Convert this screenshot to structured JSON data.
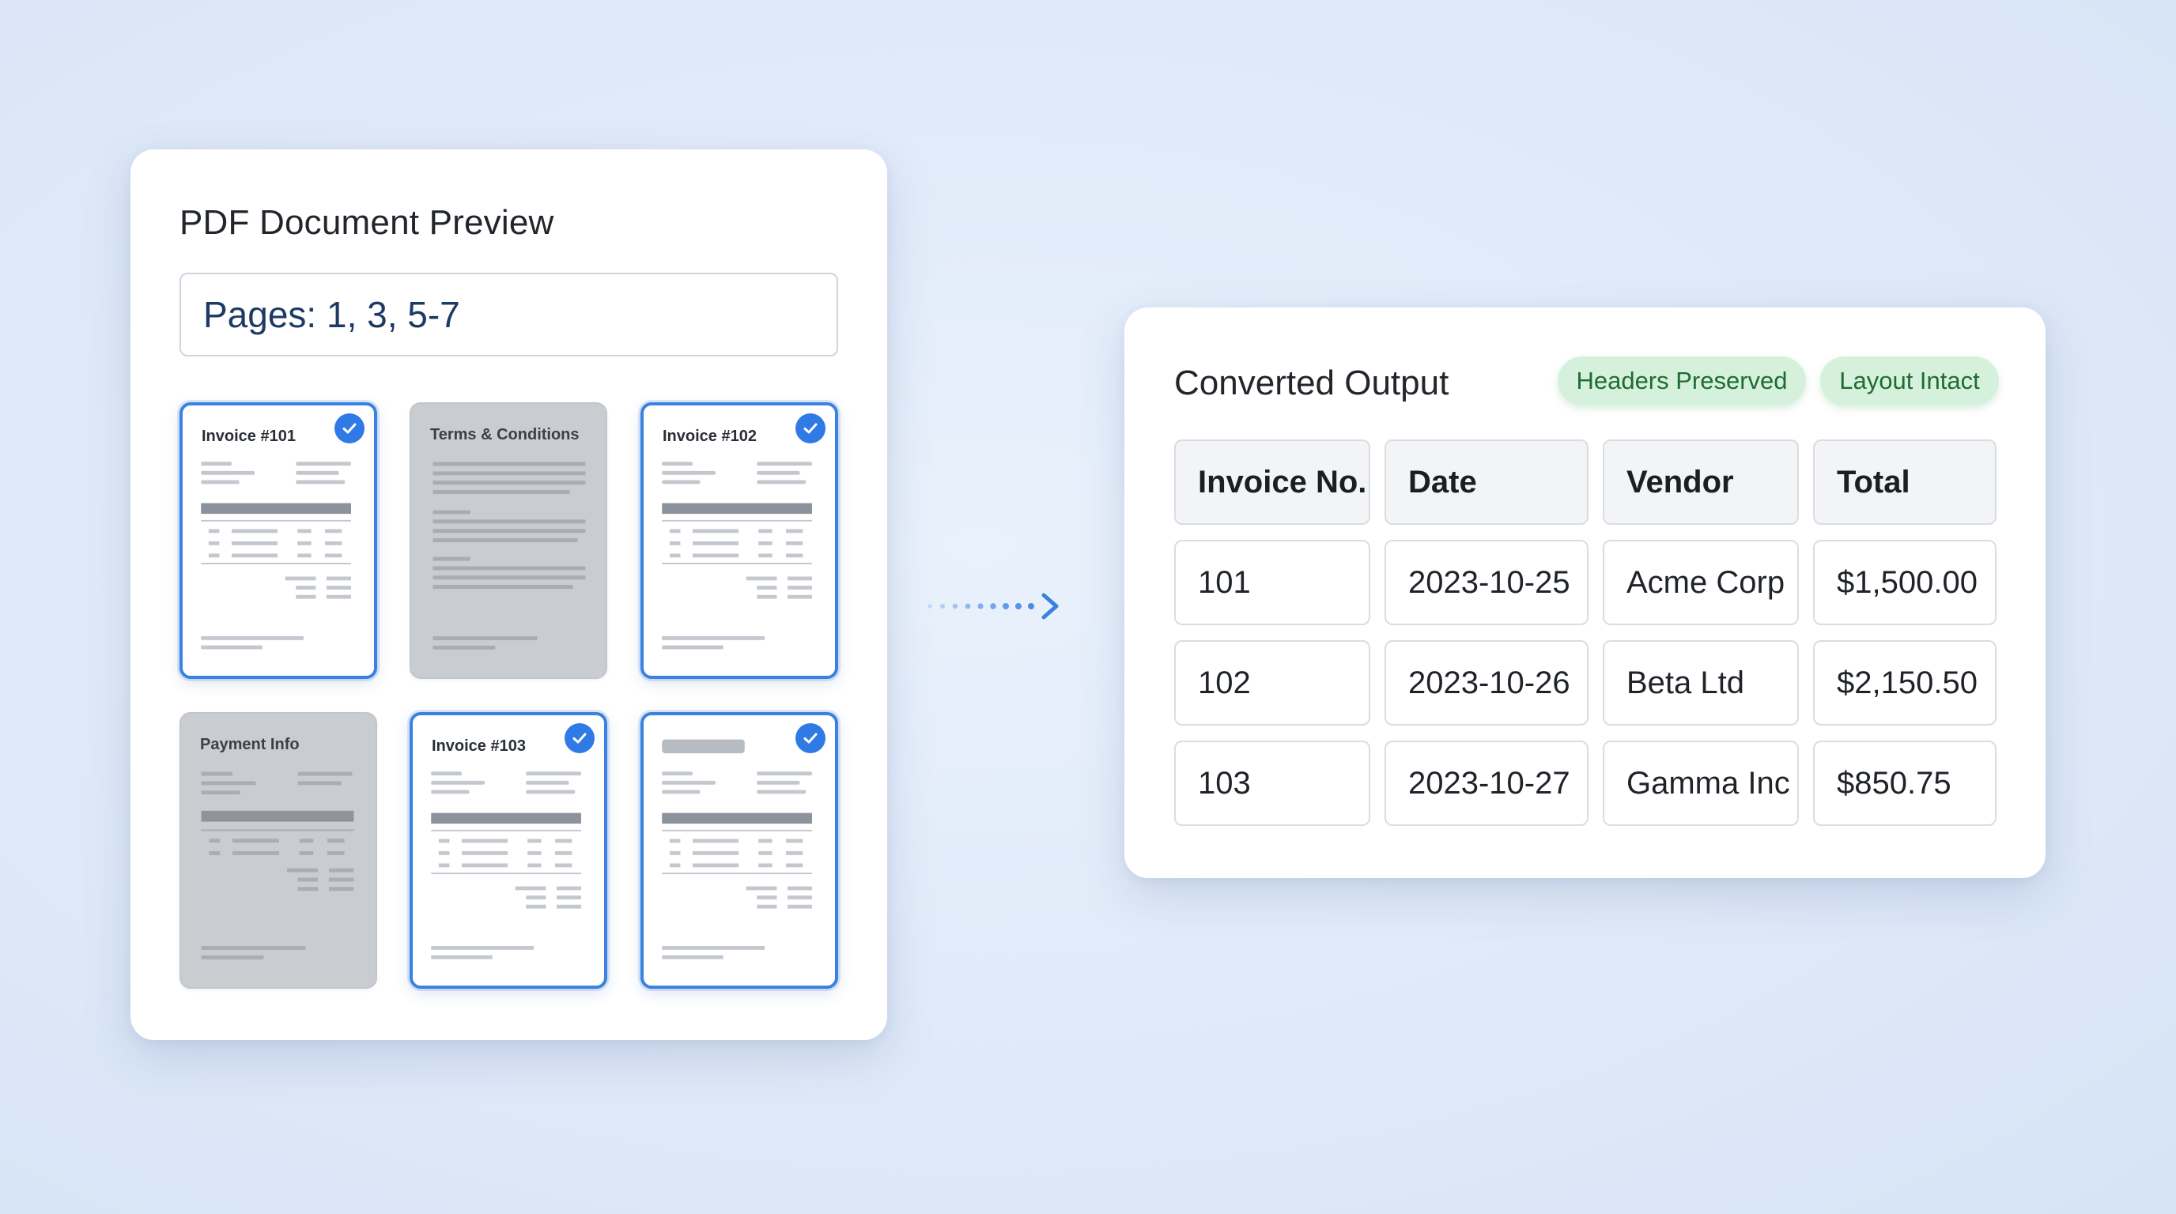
{
  "preview": {
    "title": "PDF Document Preview",
    "page_range": "Pages: 1, 3, 5-7",
    "pages": [
      {
        "title": "Invoice #101",
        "selected": true
      },
      {
        "title": "Terms & Conditions",
        "selected": false
      },
      {
        "title": "Invoice #102",
        "selected": true
      },
      {
        "title": "Payment Info",
        "selected": false
      },
      {
        "title": "Invoice #103",
        "selected": true
      },
      {
        "title": "",
        "selected": true
      }
    ]
  },
  "output": {
    "title": "Converted Output",
    "badges": [
      "Headers Preserved",
      "Layout Intact"
    ],
    "columns": [
      "Invoice No.",
      "Date",
      "Vendor",
      "Total"
    ],
    "rows": [
      [
        "101",
        "2023-10-25",
        "Acme Corp",
        "$1,500.00"
      ],
      [
        "102",
        "2023-10-26",
        "Beta Ltd",
        "$2,150.50"
      ],
      [
        "103",
        "2023-10-27",
        "Gamma Inc",
        "$850.75"
      ]
    ]
  },
  "colors": {
    "accent": "#2f7ae5",
    "badge_bg": "#d6f1db",
    "badge_text": "#1f6b34"
  }
}
